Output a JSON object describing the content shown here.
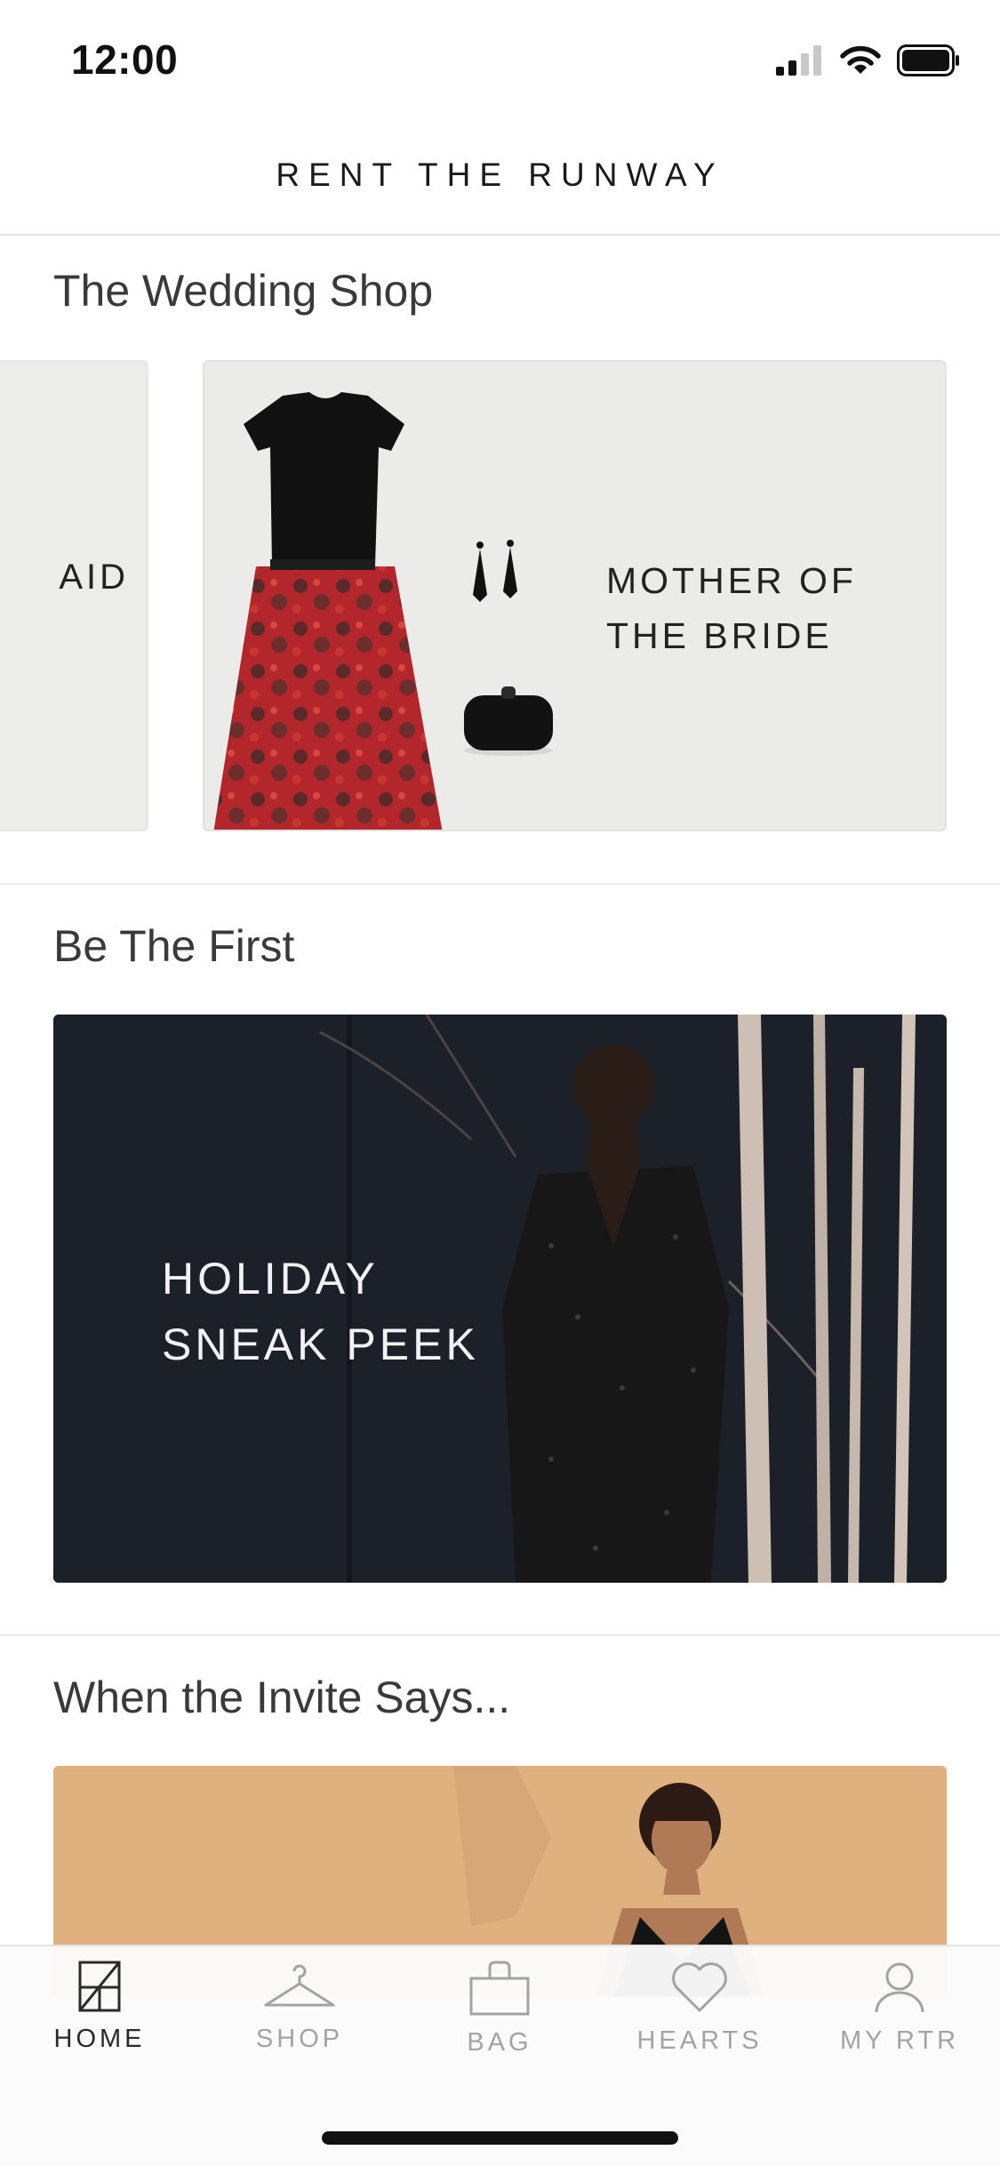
{
  "status_bar": {
    "time": "12:00"
  },
  "header": {
    "brand": "RENT THE RUNWAY"
  },
  "sections": {
    "wedding": {
      "title": "The Wedding Shop",
      "cards": [
        {
          "label": "AID"
        },
        {
          "label_line1": "MOTHER OF",
          "label_line2": "THE BRIDE"
        }
      ]
    },
    "first": {
      "title": "Be The First",
      "card": {
        "label_line1": "HOLIDAY",
        "label_line2": "SNEAK PEEK"
      }
    },
    "invite": {
      "title": "When the Invite Says..."
    }
  },
  "tab_bar": {
    "tabs": [
      {
        "label": "HOME",
        "icon": "home-icon",
        "active": true
      },
      {
        "label": "SHOP",
        "icon": "hanger-icon",
        "active": false
      },
      {
        "label": "BAG",
        "icon": "bag-icon",
        "active": false
      },
      {
        "label": "HEARTS",
        "icon": "heart-icon",
        "active": false
      },
      {
        "label": "MY RTR",
        "icon": "person-icon",
        "active": false
      }
    ]
  },
  "colors": {
    "holiday_bg": "#1c2028",
    "invite_bg": "#dfb17f",
    "skirt_red": "#b3262b",
    "active_tab": "#2a2a2a",
    "inactive_tab": "#a3a3a3"
  }
}
